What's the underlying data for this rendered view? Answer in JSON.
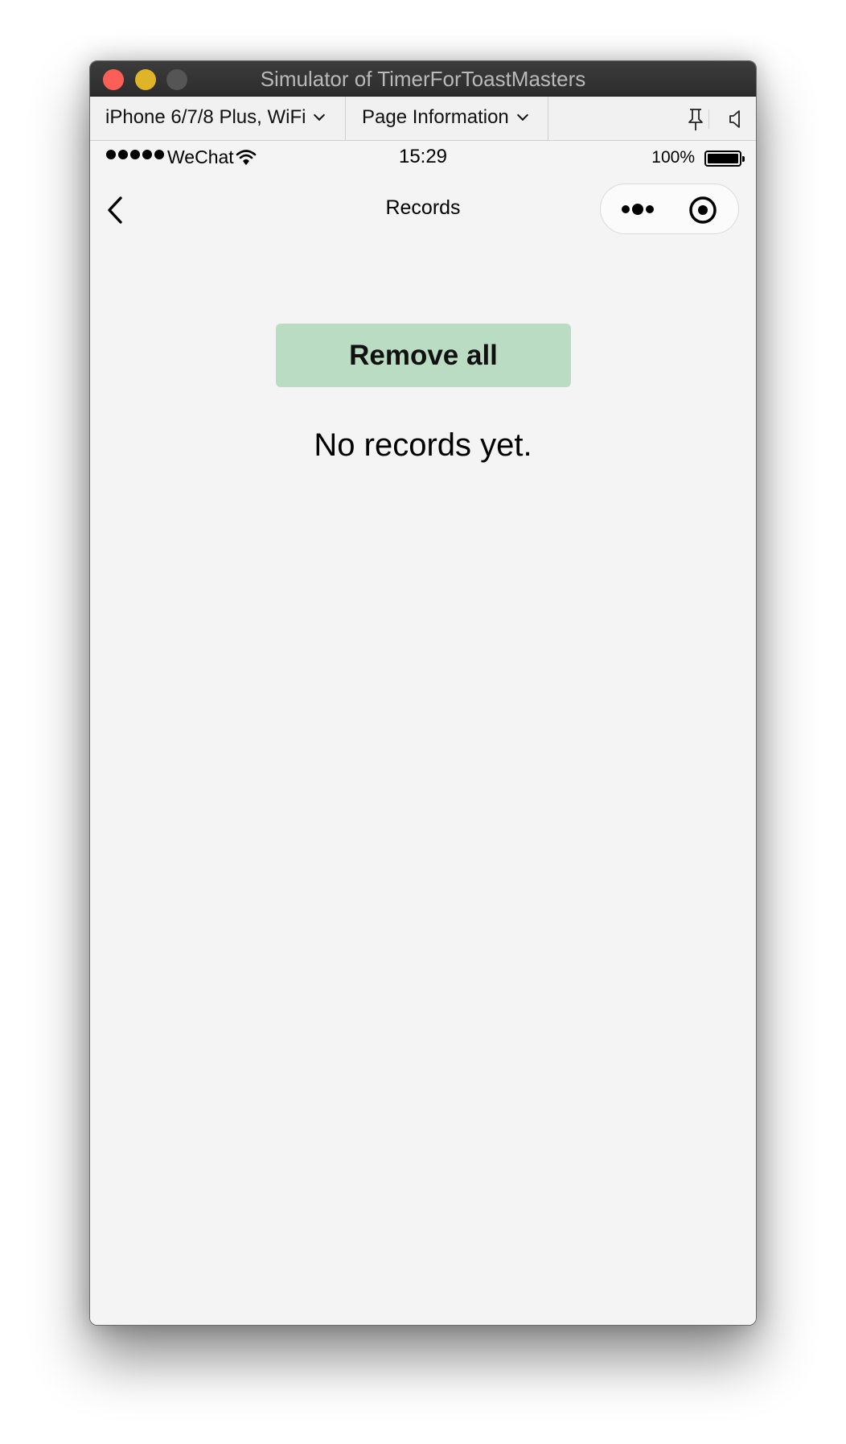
{
  "window": {
    "title": "Simulator of TimerForToastMasters"
  },
  "toolbar": {
    "device_label": "iPhone 6/7/8 Plus, WiFi",
    "page_label": "Page Information",
    "pin_icon": "pin-icon",
    "speaker_icon": "speaker-icon"
  },
  "status_bar": {
    "carrier": "WeChat",
    "time": "15:29",
    "battery": "100%",
    "signal_dots": 5
  },
  "nav": {
    "title": "Records",
    "back_icon": "back-chevron-icon",
    "more_icon": "more-dots-icon",
    "close_icon": "target-close-icon"
  },
  "content": {
    "remove_all_label": "Remove all",
    "empty_message": "No records yet."
  },
  "colors": {
    "remove_button_bg": "#b9dcc2",
    "page_bg": "#f4f4f4",
    "titlebar_bg": "#2f2f2f"
  }
}
